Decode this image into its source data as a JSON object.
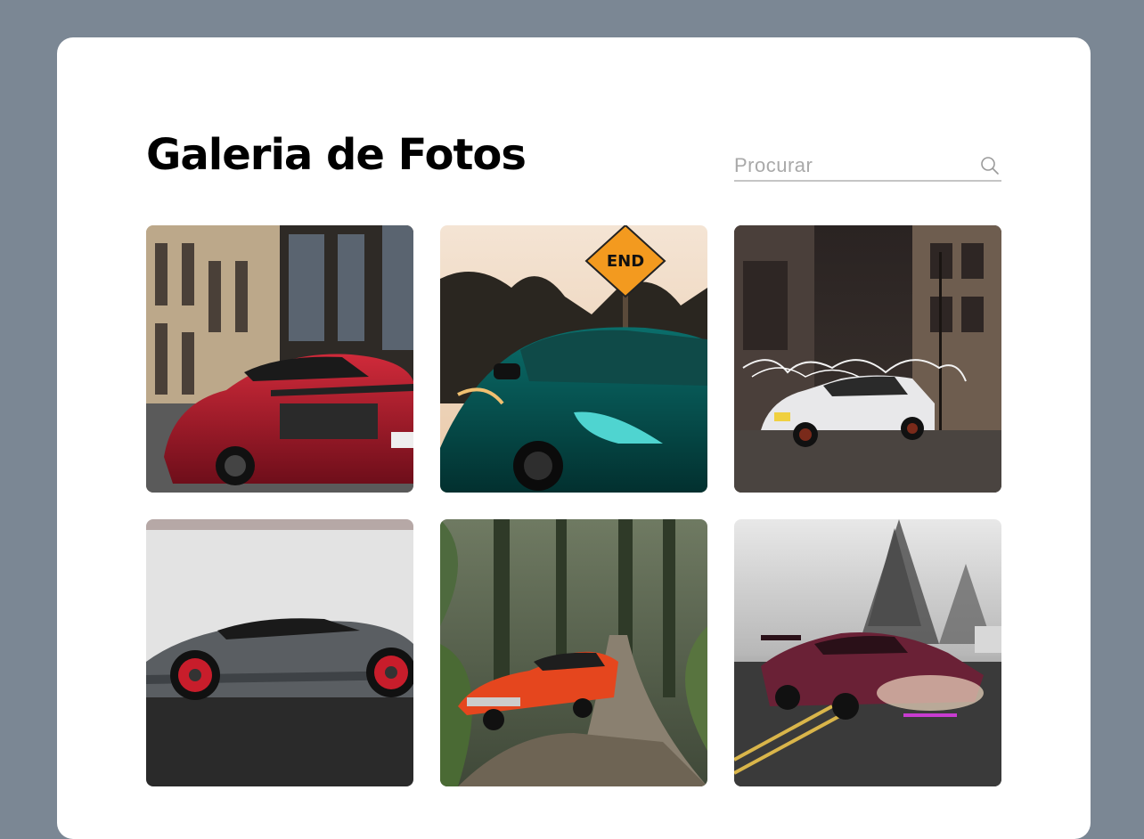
{
  "header": {
    "title": "Galeria de Fotos"
  },
  "search": {
    "placeholder": "Procurar",
    "icon": "search-icon"
  },
  "gallery": {
    "photos": [
      {
        "id": "photo-red-sports-car-street",
        "sign_text": ""
      },
      {
        "id": "photo-teal-coupe-end-sign",
        "sign_text": "END"
      },
      {
        "id": "photo-white-muscle-car-light-painting",
        "sign_text": ""
      },
      {
        "id": "photo-gray-supercar-red-wheels",
        "sign_text": ""
      },
      {
        "id": "photo-orange-classic-car-forest",
        "sign_text": ""
      },
      {
        "id": "photo-drift-car-fog-road",
        "sign_text": ""
      }
    ]
  },
  "colors": {
    "background": "#7b8794",
    "card": "#ffffff",
    "title": "#000000",
    "search_border": "#c5c5c5"
  }
}
